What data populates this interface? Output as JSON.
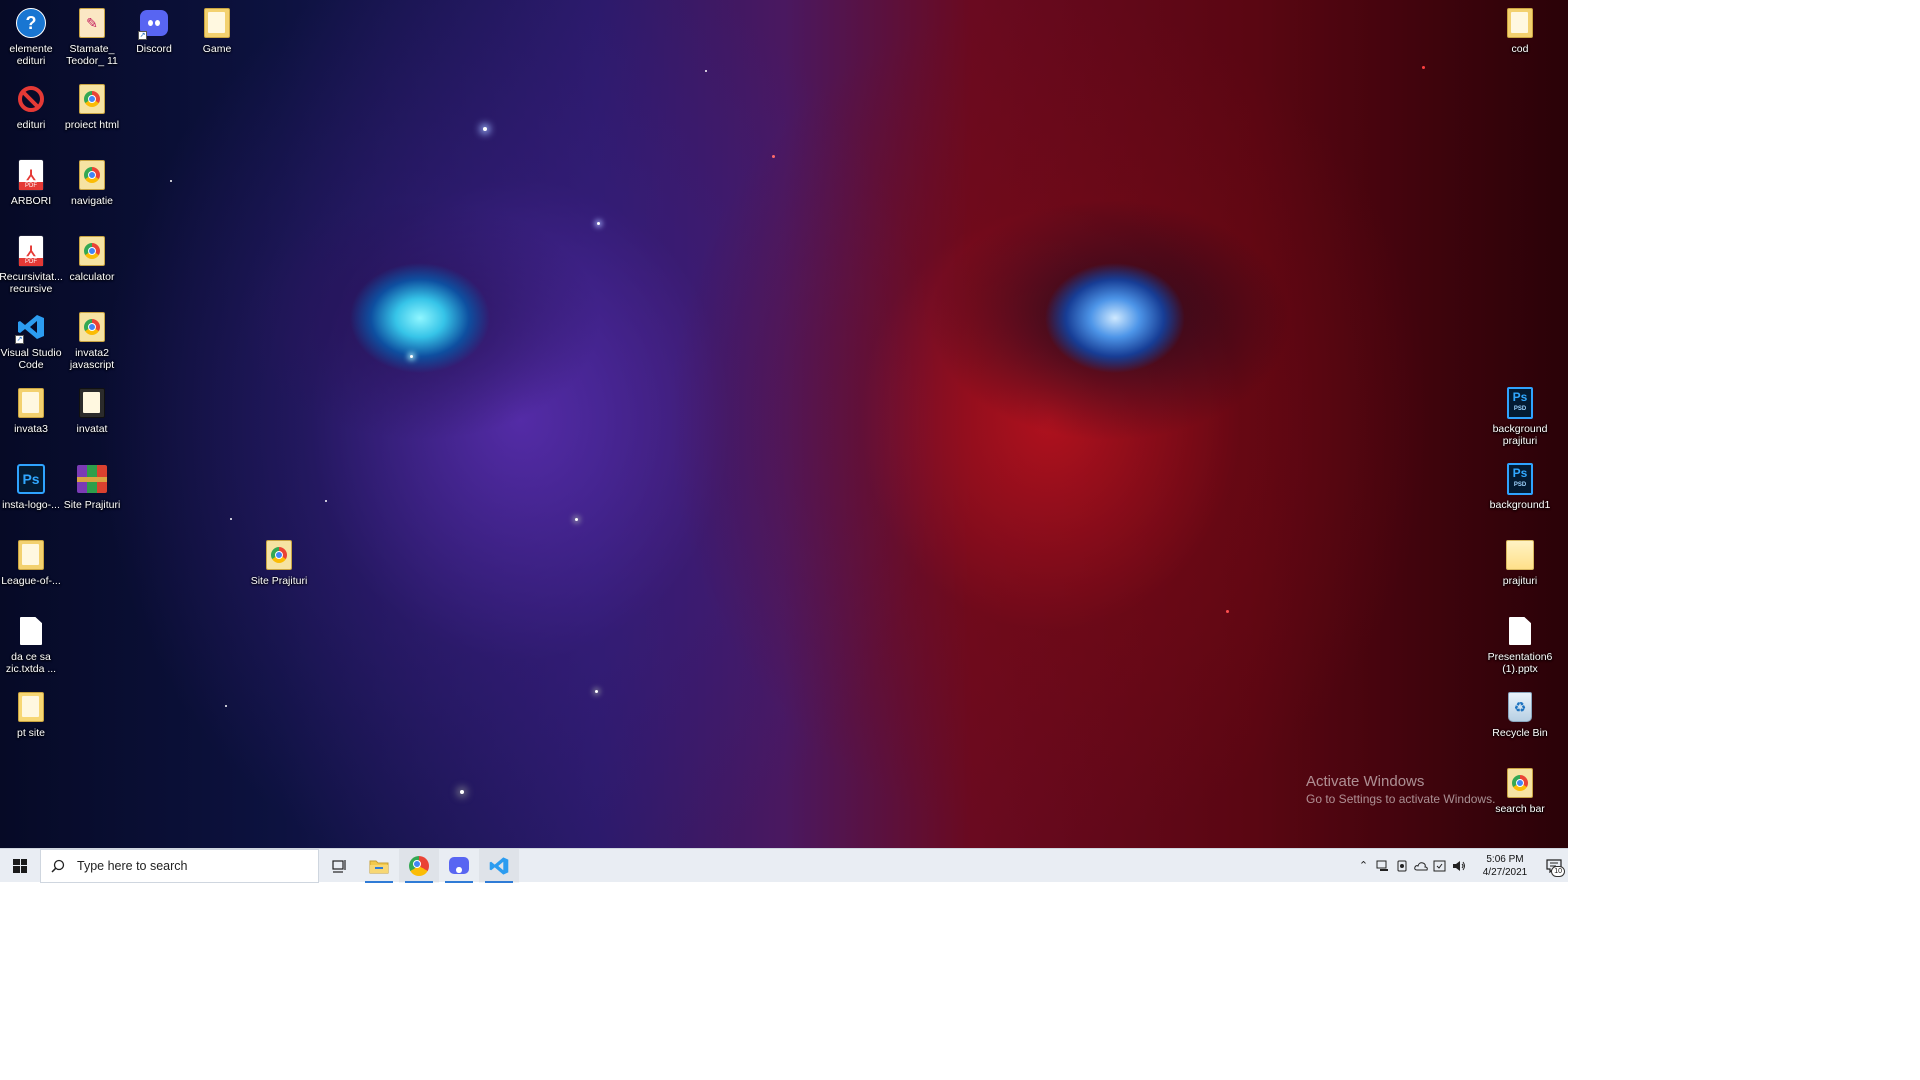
{
  "desktop": {
    "icons_left": [
      {
        "label": "elemente edituri",
        "icon": "help-icon"
      },
      {
        "label": "Stamate_ Teodor_ 11",
        "icon": "document-icon"
      },
      {
        "label": "Discord",
        "icon": "discord-icon"
      },
      {
        "label": "Game",
        "icon": "folder-icon"
      },
      {
        "label": "edituri",
        "icon": "no-entry-icon"
      },
      {
        "label": "proiect html",
        "icon": "chrome-html-icon"
      },
      {
        "label": "ARBORI",
        "icon": "pdf-icon"
      },
      {
        "label": "navigatie",
        "icon": "chrome-html-icon"
      },
      {
        "label": "Recursivitat... recursive",
        "icon": "pdf-icon"
      },
      {
        "label": "calculator",
        "icon": "chrome-html-icon"
      },
      {
        "label": "Visual Studio Code",
        "icon": "vscode-icon"
      },
      {
        "label": "invata2 javascript",
        "icon": "chrome-html-icon"
      },
      {
        "label": "invata3",
        "icon": "folder-icon"
      },
      {
        "label": "invatat",
        "icon": "folder-icon"
      },
      {
        "label": "insta-logo-...",
        "icon": "photoshop-icon"
      },
      {
        "label": "Site Prajituri",
        "icon": "winrar-icon"
      },
      {
        "label": "League-of-...",
        "icon": "folder-icon"
      },
      {
        "label": "Site Prajituri",
        "icon": "chrome-html-icon"
      },
      {
        "label": "da ce sa zic.txtda ...",
        "icon": "blank-file-icon"
      },
      {
        "label": "pt site",
        "icon": "folder-icon"
      }
    ],
    "icons_right": [
      {
        "label": "cod",
        "icon": "folder-icon"
      },
      {
        "label": "background prajituri",
        "icon": "psd-icon"
      },
      {
        "label": "background1",
        "icon": "psd-icon"
      },
      {
        "label": "prajituri",
        "icon": "image-icon"
      },
      {
        "label": "Presentation6 (1).pptx",
        "icon": "blank-file-icon"
      },
      {
        "label": "Recycle Bin",
        "icon": "recycle-bin-icon"
      },
      {
        "label": "search bar",
        "icon": "chrome-html-icon"
      }
    ],
    "watermark": {
      "title": "Activate Windows",
      "subtitle": "Go to Settings to activate Windows."
    }
  },
  "taskbar": {
    "search_placeholder": "Type here to search",
    "pinned": [
      "task-view",
      "file-explorer",
      "chrome",
      "discord",
      "vscode"
    ],
    "clock": {
      "time": "5:06 PM",
      "date": "4/27/2021"
    },
    "notification_count": "10",
    "accent_color": "#2f7bd6"
  }
}
